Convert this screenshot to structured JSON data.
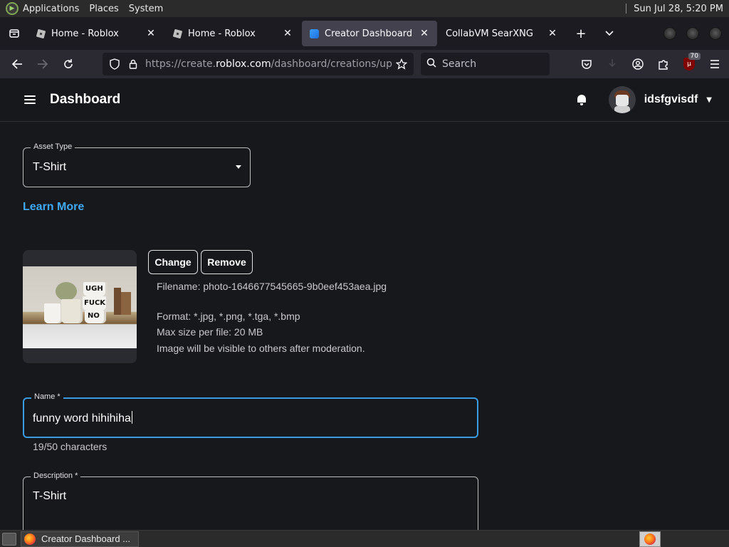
{
  "system_panel": {
    "menus": [
      "Applications",
      "Places",
      "System"
    ],
    "clock": "Sun Jul 28,  5:20 PM"
  },
  "browser": {
    "tabs": [
      {
        "label": "Home - Roblox",
        "icon": "roblox-icon",
        "active": false
      },
      {
        "label": "Home - Roblox",
        "icon": "roblox-icon",
        "active": false
      },
      {
        "label": "Creator Dashboard",
        "icon": "creator-dashboard-icon",
        "active": true
      },
      {
        "label": "CollabVM SearXNG",
        "icon": "",
        "active": false
      }
    ],
    "url": {
      "prefix": "https://create.",
      "domain": "roblox.com",
      "path": "/dashboard/creations/upload"
    },
    "search_placeholder": "Search",
    "extension_badge": "70"
  },
  "app": {
    "title": "Dashboard",
    "username": "idsfgvisdf"
  },
  "form": {
    "asset_type": {
      "legend": "Asset Type",
      "value": "T-Shirt"
    },
    "learn_more": "Learn More",
    "change_label": "Change",
    "remove_label": "Remove",
    "filename": "Filename: photo-1646677545665-9b0eef453aea.jpg",
    "format": "Format: *.jpg, *.png, *.tga, *.bmp",
    "max_size": "Max size per file: 20 MB",
    "moderation_note": "Image will be visible to others after moderation.",
    "image_text": [
      "UGH",
      "FUCK",
      "NO"
    ],
    "name": {
      "legend": "Name *",
      "value": "funny word hihihiha",
      "counter": "19/50 characters"
    },
    "description": {
      "legend": "Description *",
      "value": "T-Shirt"
    }
  },
  "taskbar": {
    "window_label": "Creator Dashboard ..."
  }
}
